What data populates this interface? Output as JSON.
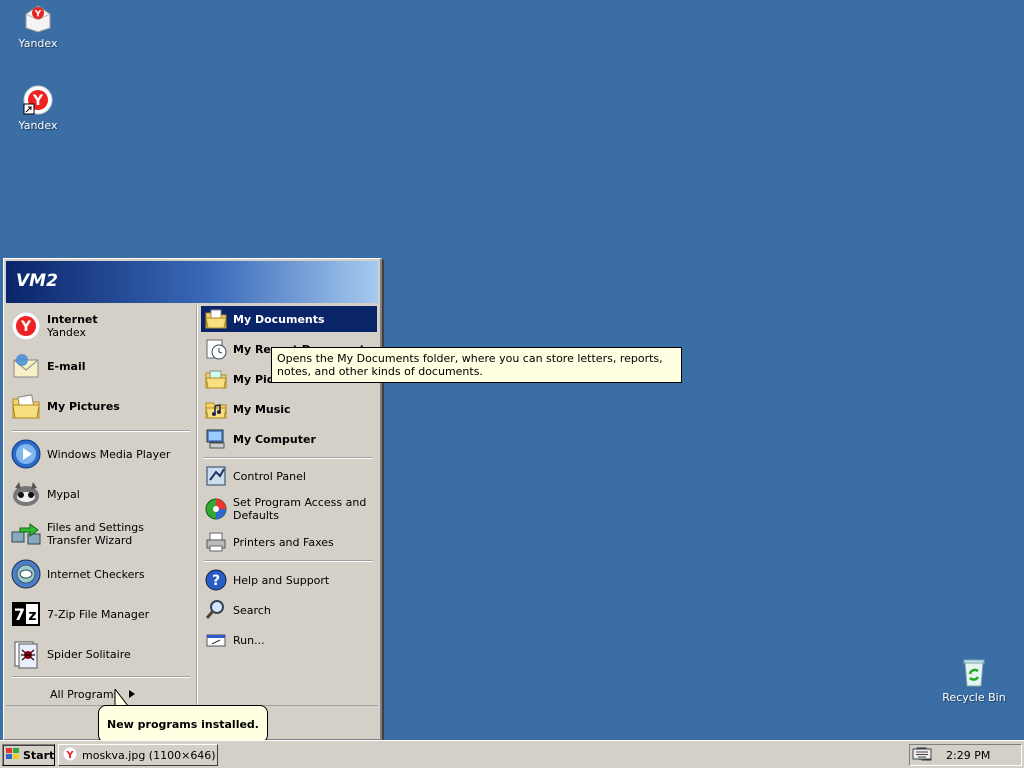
{
  "desktop": {
    "background_color": "#3a6ea5",
    "icons": [
      {
        "label": "Yandex",
        "icon": "yandex-icon"
      },
      {
        "label": "Yandex",
        "icon": "yandex-shortcut-icon"
      },
      {
        "label": "Recycle Bin",
        "icon": "recycle-bin-icon"
      }
    ]
  },
  "start_menu": {
    "user_name": "VM2",
    "pinned": [
      {
        "title": "Internet",
        "subtitle": "Yandex",
        "icon": "yandex-icon"
      },
      {
        "title": "E-mail",
        "icon": "email-icon"
      },
      {
        "title": "My Pictures",
        "icon": "pictures-folder-icon"
      }
    ],
    "recent_programs": [
      {
        "label": "Windows Media Player",
        "icon": "media-player-icon"
      },
      {
        "label": "Mypal",
        "icon": "mypal-icon"
      },
      {
        "label": "Files and Settings Transfer Wizard",
        "icon": "transfer-wizard-icon"
      },
      {
        "label": "Internet Checkers",
        "icon": "checkers-icon"
      },
      {
        "label": "7-Zip File Manager",
        "icon": "7zip-icon"
      },
      {
        "label": "Spider Solitaire",
        "icon": "spider-solitaire-icon"
      }
    ],
    "all_programs": "All Programs",
    "right_top": [
      {
        "label": "My Documents",
        "icon": "documents-folder-icon",
        "highlighted": true
      },
      {
        "label": "My Recent Documents",
        "icon": "recent-documents-icon"
      },
      {
        "label": "My Pictures",
        "icon": "pictures-folder-icon"
      },
      {
        "label": "My Music",
        "icon": "music-folder-icon"
      },
      {
        "label": "My Computer",
        "icon": "computer-icon"
      }
    ],
    "right_middle": [
      {
        "label": "Control Panel",
        "icon": "control-panel-icon"
      },
      {
        "label": "Set Program Access and Defaults",
        "icon": "program-access-icon"
      },
      {
        "label": "Printers and Faxes",
        "icon": "printer-icon"
      }
    ],
    "right_bottom": [
      {
        "label": "Help and Support",
        "icon": "help-icon"
      },
      {
        "label": "Search",
        "icon": "search-icon"
      },
      {
        "label": "Run...",
        "icon": "run-icon"
      }
    ]
  },
  "tooltip": {
    "text": "Opens the My Documents folder, where you can store letters, reports, notes, and other kinds of documents."
  },
  "balloon": {
    "text": "New programs installed."
  },
  "taskbar": {
    "start_label": "Start",
    "tasks": [
      {
        "label": "moskva.jpg (1100×646) ...",
        "icon": "yandex-icon"
      }
    ],
    "clock": "2:29 PM"
  },
  "colors": {
    "menu_highlight": "#0a246a",
    "face": "#d4d0c8",
    "tooltip_bg": "#ffffe1"
  }
}
